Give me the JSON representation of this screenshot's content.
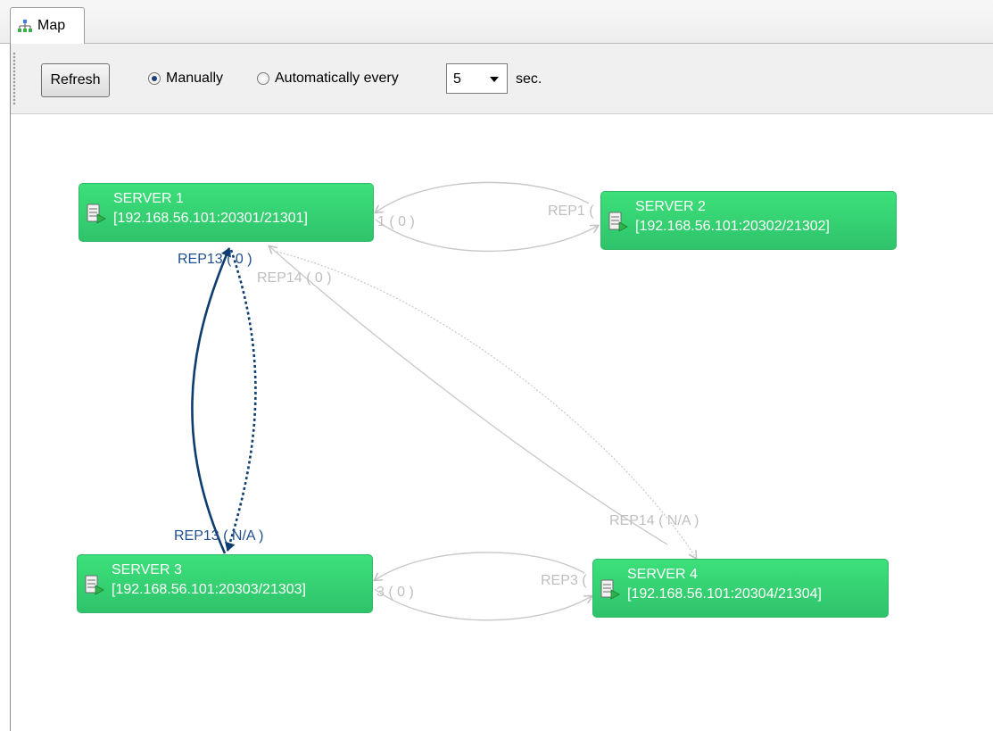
{
  "tab": {
    "label": "Map",
    "icon": "network-map-icon"
  },
  "toolbar": {
    "refresh_label": "Refresh",
    "radio_manual_label": "Manually",
    "radio_auto_label": "Automatically every",
    "interval_value": "5",
    "interval_unit": "sec.",
    "selected_mode": "Manually"
  },
  "servers": [
    {
      "name": "SERVER 1",
      "address": "[192.168.56.101:20301/21301]"
    },
    {
      "name": "SERVER 2",
      "address": "[192.168.56.101:20302/21302]"
    },
    {
      "name": "SERVER 3",
      "address": "[192.168.56.101:20303/21303]"
    },
    {
      "name": "SERVER 4",
      "address": "[192.168.56.101:20304/21304]"
    }
  ],
  "edge_labels": {
    "s1_s2_left": "1 ( 0 )",
    "s1_s2_right": "REP1 (",
    "s1_s3_top": "REP13 ( 0 )",
    "s1_s3_bottom": "REP13 ( N/A )",
    "s1_s4_top": "REP14 ( 0 )",
    "s1_s4_bottom": "REP14 ( N/A )",
    "s3_s4_left": "3 ( 0 )",
    "s3_s4_right": "REP3 ("
  },
  "colors": {
    "server_green": "#33cc70",
    "link_gray": "#bfbfbf",
    "link_blue": "#0d3c6e"
  }
}
